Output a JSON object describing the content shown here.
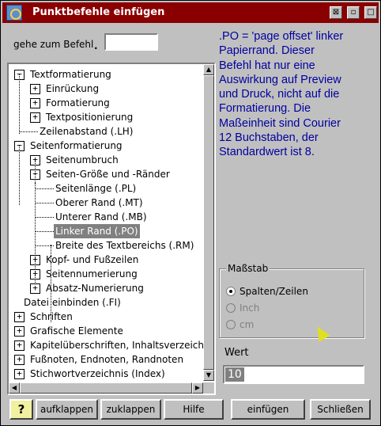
{
  "window": {
    "title": "Punktbefehle einfügen",
    "title_buttons": [
      "⊠",
      "▫",
      "□"
    ]
  },
  "goto": {
    "label": "gehe zum Befehl",
    "dot": ".",
    "value": ""
  },
  "tree": {
    "items": [
      {
        "label": "Textformatierung",
        "expander": "−"
      },
      {
        "label": "Einrückung",
        "expander": "+"
      },
      {
        "label": "Formatierung",
        "expander": "+"
      },
      {
        "label": "Textpositionierung",
        "expander": "+"
      },
      {
        "label": "Zeilenabstand (.LH)",
        "expander": ""
      },
      {
        "label": "Seitenformatierung",
        "expander": "−"
      },
      {
        "label": "Seitenumbruch",
        "expander": "+"
      },
      {
        "label": "Seiten-Größe und -Ränder",
        "expander": "−"
      },
      {
        "label": "Seitenlänge (.PL)",
        "expander": ""
      },
      {
        "label": "Oberer Rand (.MT)",
        "expander": ""
      },
      {
        "label": "Unterer Rand (.MB)",
        "expander": ""
      },
      {
        "label": "Linker Rand (.PO)",
        "expander": "",
        "selected": true
      },
      {
        "label": "Breite des Textbereichs (.RM)",
        "expander": ""
      },
      {
        "label": "Kopf- und Fußzeilen",
        "expander": "+"
      },
      {
        "label": "Seitennumerierung",
        "expander": "+"
      },
      {
        "label": "Absatz-Numerierung",
        "expander": "+"
      },
      {
        "label": "Datei einbinden (.FI)",
        "expander": ""
      },
      {
        "label": "Schriften",
        "expander": "+"
      },
      {
        "label": "Grafische Elemente",
        "expander": "+"
      },
      {
        "label": "Kapitelüberschriften, Inhaltsverzeichnis",
        "expander": "+"
      },
      {
        "label": "Fußnoten, Endnoten, Randnoten",
        "expander": "+"
      },
      {
        "label": "Stichwortverzeichnis (Index)",
        "expander": "+"
      }
    ]
  },
  "info_text": ".PO = 'page offset' linker\nPapierrand. Dieser\nBefehl hat nur eine\nAuswirkung auf Preview\nund Druck, nicht auf die\nFormatierung. Die\nMaßeinheit sind Courier\n12 Buchstaben, der\nStandardwert ist 8.",
  "massstab": {
    "title": "Maßstab",
    "options": [
      {
        "label": "Spalten/Zeilen",
        "checked": true
      },
      {
        "label": "Inch",
        "checked": false
      },
      {
        "label": "cm",
        "checked": false
      }
    ]
  },
  "wert": {
    "label": "Wert",
    "value": "10"
  },
  "buttons": {
    "help_q": "?",
    "expand": "aufklappen",
    "collapse": "zuklappen",
    "help": "Hilfe",
    "insert": "einfügen",
    "close": "Schließen"
  },
  "colors": {
    "titlebar": "#8a0000",
    "info_text": "#0000a0",
    "selection": "#808080"
  }
}
